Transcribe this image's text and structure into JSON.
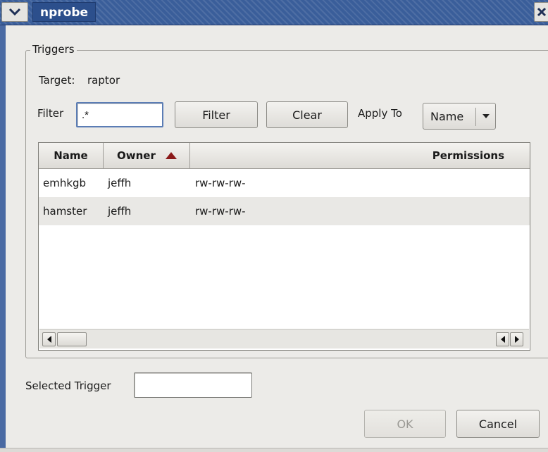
{
  "window": {
    "title": "nprobe",
    "menu_icon": "chevron-down-icon",
    "close_icon": "close-icon"
  },
  "triggers": {
    "legend": "Triggers",
    "target_label": "Target:",
    "target_value": "raptor",
    "filter_label": "Filter",
    "filter_value": ".*",
    "filter_button": "Filter",
    "clear_button": "Clear",
    "apply_to_label": "Apply To",
    "apply_to_selected": "Name"
  },
  "table": {
    "columns": [
      {
        "label": "Name"
      },
      {
        "label": "Owner",
        "sort": "ascending",
        "sort_icon": "sort-up-icon"
      },
      {
        "label": "Permissions"
      }
    ],
    "rows": [
      {
        "name": "emhkgb",
        "owner": "jeffh",
        "permissions": "rw-rw-rw-"
      },
      {
        "name": "hamster",
        "owner": "jeffh",
        "permissions": "rw-rw-rw-"
      }
    ]
  },
  "selected_trigger": {
    "label": "Selected Trigger",
    "value": ""
  },
  "buttons": {
    "ok": "OK",
    "cancel": "Cancel"
  },
  "colors": {
    "titlebar": "#3a5e9a",
    "sort_arrow": "#8b1a1a"
  }
}
